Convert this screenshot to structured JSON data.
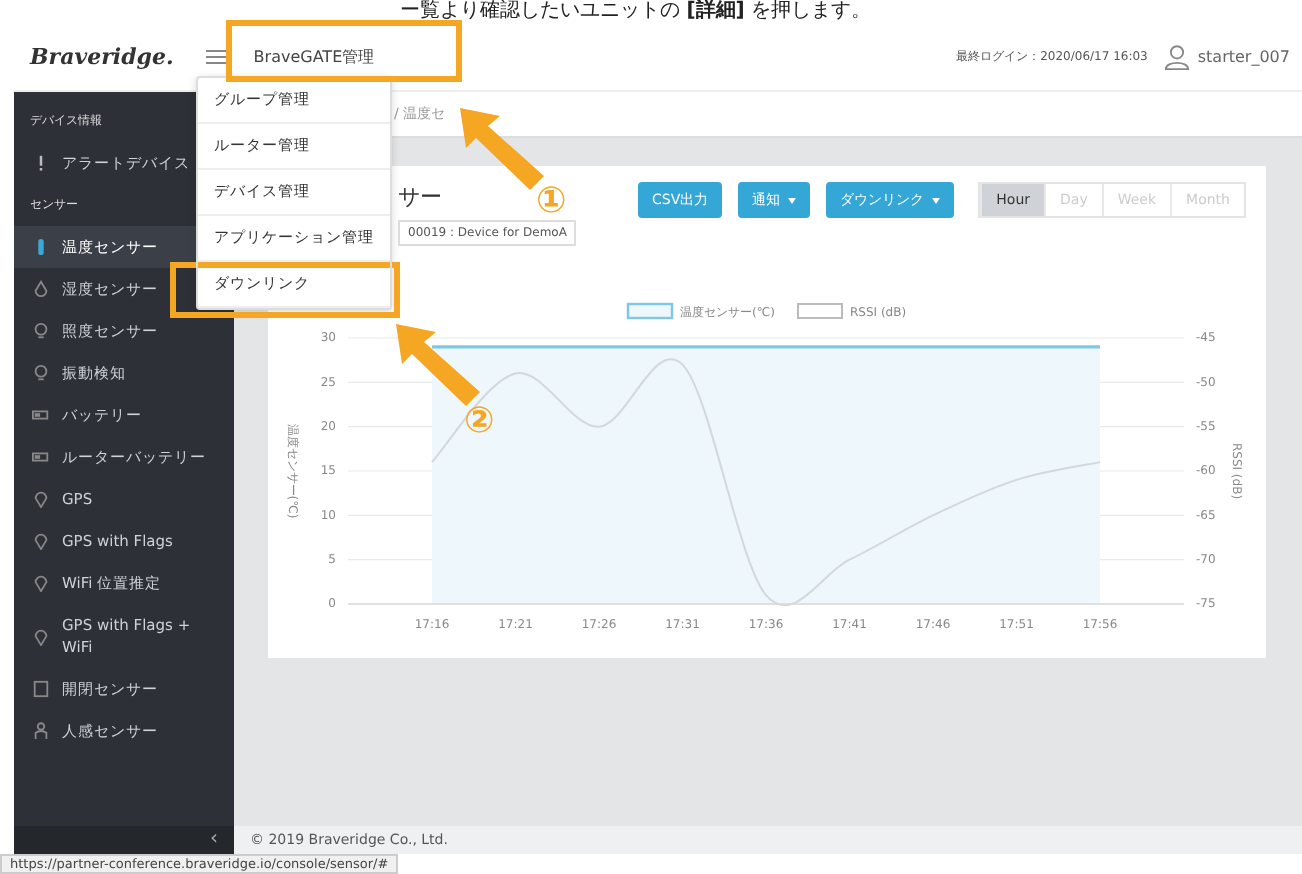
{
  "caption": "ー覧より確認したいユニットの **[詳細]** を押します。",
  "header": {
    "logo": "Braveridge.",
    "nav_item": "BraveGATE管理",
    "last_login": "最終ログイン：2020/06/17 16:03",
    "user": "starter_007"
  },
  "menu": {
    "items": [
      {
        "label": "グループ管理",
        "highlighted": false
      },
      {
        "label": "ルーター管理",
        "highlighted": false
      },
      {
        "label": "デバイス管理",
        "highlighted": false
      },
      {
        "label": "アプリケーション管理",
        "highlighted": false
      },
      {
        "label": "ダウンリンク",
        "highlighted": true
      }
    ]
  },
  "sidebar": {
    "sections": [
      {
        "title": "デバイス情報",
        "items": [
          {
            "label": "アラートデバイス",
            "selected": false
          }
        ]
      },
      {
        "title": "センサー",
        "items": [
          {
            "label": "温度センサー",
            "selected": true
          },
          {
            "label": "湿度センサー",
            "selected": false
          },
          {
            "label": "照度センサー",
            "selected": false
          },
          {
            "label": "振動検知",
            "selected": false
          },
          {
            "label": "バッテリー",
            "selected": false
          },
          {
            "label": "ルーターバッテリー",
            "selected": false
          },
          {
            "label": "GPS",
            "selected": false
          },
          {
            "label": "GPS with Flags",
            "selected": false
          },
          {
            "label": "WiFi 位置推定",
            "selected": false
          },
          {
            "label": "GPS with Flags + WiFi",
            "selected": false
          },
          {
            "label": "開閉センサー",
            "selected": false
          },
          {
            "label": "人感センサー",
            "selected": false
          }
        ]
      }
    ],
    "collapse": "‹"
  },
  "breadcrumb": "/ 温度セ",
  "page": {
    "title": "サー",
    "device": "00019 : Device for DemoA",
    "buttons": [
      {
        "label": "CSV出力",
        "dropdown": false
      },
      {
        "label": "通知",
        "dropdown": true
      },
      {
        "label": "ダウンリンク",
        "dropdown": true
      }
    ],
    "ranges": [
      {
        "label": "Hour",
        "selected": true
      },
      {
        "label": "Day",
        "selected": false
      },
      {
        "label": "Week",
        "selected": false
      },
      {
        "label": "Month",
        "selected": false
      }
    ]
  },
  "temperature_chart": {
    "chart_data": {
      "type": "area",
      "ylabel": "温度センサー(℃)",
      "categories": [
        "17:16",
        "17:21",
        "17:26",
        "17:31",
        "17:36",
        "17:41",
        "17:46",
        "17:51",
        "17:56"
      ],
      "series": [
        {
          "name": "温度センサー(℃)",
          "color": "#7cc8e6",
          "values": [
            29,
            29,
            29,
            29,
            29,
            29,
            29,
            29,
            29
          ]
        }
      ],
      "ylim": [
        0,
        30
      ],
      "yticks": [
        0,
        5,
        10,
        15,
        20,
        25,
        30
      ],
      "grid": true
    }
  },
  "rssi_chart": {
    "chart_data": {
      "type": "line",
      "ylabel": "RSSI (dB)",
      "series": [
        {
          "name": "RSSI (dB)",
          "color": "#d3d8db",
          "values": [
            -59,
            -49,
            -55,
            -48,
            -74,
            -70,
            -65,
            -61,
            -59
          ]
        }
      ],
      "ylim": [
        -75,
        -45
      ],
      "yticks": [
        -75,
        -70,
        -65,
        -60,
        -55,
        -50,
        -45
      ]
    }
  },
  "footer": "© 2019 Braveridge Co., Ltd.",
  "status_url": "https://partner-conference.braveridge.io/console/sensor/#",
  "annotations": [
    {
      "number": "①"
    },
    {
      "number": "②"
    }
  ]
}
